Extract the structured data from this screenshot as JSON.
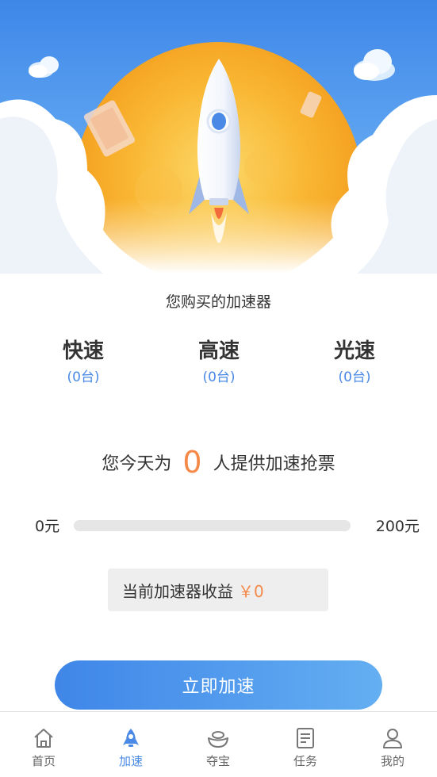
{
  "hero": {
    "illustration": "rocket-launch-over-sun-and-clouds",
    "colors": {
      "sky": "#3e87e8",
      "sun": "#f7a41d",
      "rocket": "#ffffff",
      "window": "#4a8ae6"
    }
  },
  "purchase": {
    "title": "您购买的加速器",
    "tiers": [
      {
        "name": "快速",
        "count": "(0台)"
      },
      {
        "name": "高速",
        "count": "(0台)"
      },
      {
        "name": "光速",
        "count": "(0台)"
      }
    ]
  },
  "today": {
    "prefix": "您今天为",
    "count": "0",
    "suffix": "人提供加速抢票"
  },
  "progress": {
    "min_label": "0元",
    "max_label": "200元",
    "fraction": 0
  },
  "earnings": {
    "label": "当前加速器收益",
    "amount": "￥0"
  },
  "cta": {
    "label": "立即加速"
  },
  "tabbar": {
    "active": "加速",
    "tabs": [
      {
        "label": "首页",
        "icon": "home-icon"
      },
      {
        "label": "加速",
        "icon": "rocket-icon"
      },
      {
        "label": "夺宝",
        "icon": "treasure-icon"
      },
      {
        "label": "任务",
        "icon": "task-icon"
      },
      {
        "label": "我的",
        "icon": "profile-icon"
      }
    ]
  },
  "colors": {
    "accent": "#4a8ae6",
    "highlight": "#f5894a",
    "track": "#e6e6e6"
  }
}
